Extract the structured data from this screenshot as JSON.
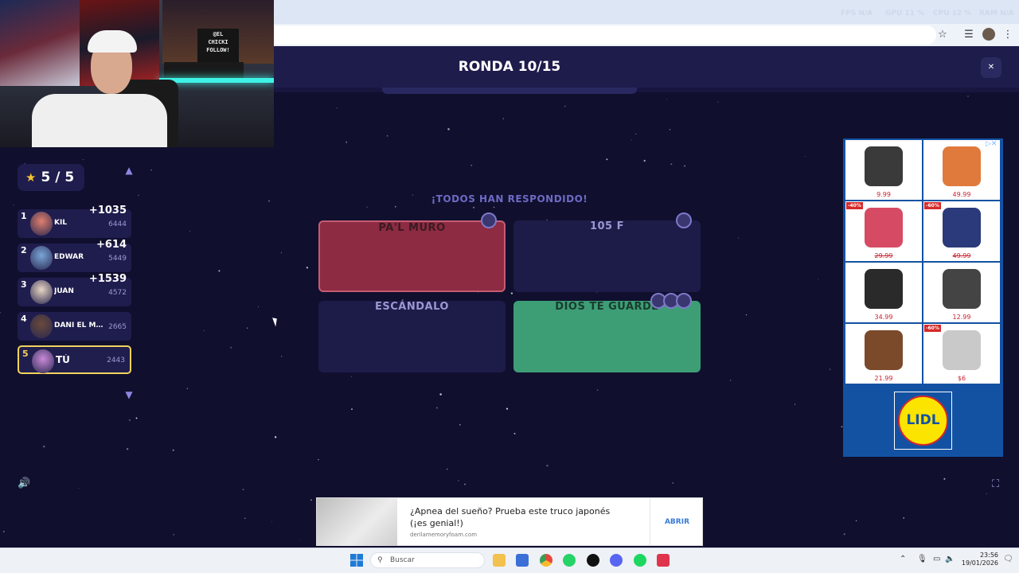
{
  "header": {
    "title": "RONDA 10/15",
    "close_icon": "close-circle-icon"
  },
  "browser": {
    "perf": [
      "FPS N/A",
      "GPU 11 %",
      "CPU 12 %",
      "RAM N/A"
    ],
    "bookmark_icon": "star-outline-icon",
    "tab_search_icon": "tab-list-icon",
    "menu_icon": "kebab-menu-icon"
  },
  "webcam": {
    "sign_lines": [
      "@EL",
      "CHICKI",
      "FOLLOW!"
    ]
  },
  "score": {
    "value": "5 / 5",
    "icon": "star-icon"
  },
  "leaderboard": {
    "players": [
      {
        "rank": "1",
        "name": "KIL",
        "points": "6444",
        "delta": "+1035",
        "avatar_color": "#e0806c"
      },
      {
        "rank": "2",
        "name": "EDWAR",
        "points": "5449",
        "delta": "+614",
        "avatar_color": "#7aa6d9"
      },
      {
        "rank": "3",
        "name": "JUAN",
        "points": "4572",
        "delta": "+1539",
        "avatar_color": "#e8d6c4"
      },
      {
        "rank": "4",
        "name": "DANI EL MA...",
        "points": "2665",
        "delta": "",
        "avatar_color": "#6a4a3a"
      },
      {
        "rank": "5",
        "name": "TÚ",
        "points": "2443",
        "delta": "",
        "avatar_color": "#c98ad8"
      }
    ]
  },
  "question": {
    "status": "¡TODOS HAN RESPONDIDO!",
    "answers": [
      {
        "label": "PA'L MURO",
        "state": "wrong"
      },
      {
        "label": "105 F",
        "state": "neutral"
      },
      {
        "label": "ESCÁNDALO",
        "state": "neutral"
      },
      {
        "label": "DIOS TE GUARDE",
        "state": "correct"
      }
    ]
  },
  "ad_right": {
    "items": [
      {
        "price": "9.99",
        "discount": "",
        "strike": false
      },
      {
        "price": "49.99",
        "discount": "",
        "strike": false
      },
      {
        "price": "29.99",
        "discount": "-40%",
        "strike": true
      },
      {
        "price": "49.99",
        "discount": "-60%",
        "strike": true
      },
      {
        "price": "34.99",
        "discount": "",
        "strike": false
      },
      {
        "price": "12.99",
        "discount": "",
        "strike": false
      },
      {
        "price": "21.99",
        "discount": "",
        "strike": false
      },
      {
        "price": "$6",
        "discount": "-60%",
        "strike": false
      }
    ],
    "logo": "LIDL"
  },
  "ad_bottom": {
    "headline": "¿Apnea del sueño? Prueba este truco japonés (¡es genial!)",
    "site": "derilamemoryfoam.com",
    "cta": "ABRIR"
  },
  "controls": {
    "volume_icon": "speaker-icon",
    "fullscreen_icon": "fullscreen-icon"
  },
  "taskbar": {
    "search_placeholder": "Buscar",
    "time": "23:56",
    "date": "19/01/2026"
  }
}
